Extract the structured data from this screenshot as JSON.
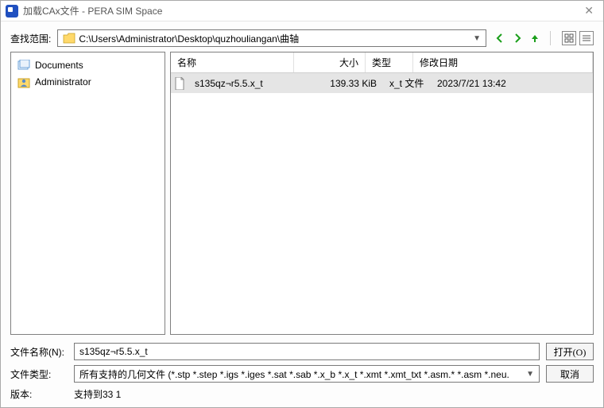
{
  "window": {
    "title": "加载CAx文件 - PERA SIM Space"
  },
  "path": {
    "label": "查找范围:",
    "value": "C:\\Users\\Administrator\\Desktop\\quzhouliangan\\曲轴"
  },
  "tree": {
    "items": [
      {
        "label": "Documents",
        "icon": "documents"
      },
      {
        "label": "Administrator",
        "icon": "user"
      }
    ]
  },
  "list": {
    "headers": {
      "name": "名称",
      "size": "大小",
      "type": "类型",
      "date": "修改日期"
    },
    "rows": [
      {
        "name": "s135qz¬r5.5.x_t",
        "size": "139.33 KiB",
        "type": "x_t 文件",
        "date": "2023/7/21 13:42"
      }
    ]
  },
  "filename": {
    "label": "文件名称(N):",
    "value": "s135qz¬r5.5.x_t"
  },
  "filetype": {
    "label": "文件类型:",
    "value": "所有支持的几何文件 (*.stp *.step *.igs *.iges *.sat *.sab *.x_b *.x_t *.xmt *.xmt_txt *.asm.* *.asm *.neu."
  },
  "version": {
    "label": "版本:",
    "value": "支持到33 1"
  },
  "buttons": {
    "open": "打开(O)",
    "cancel": "取消"
  }
}
